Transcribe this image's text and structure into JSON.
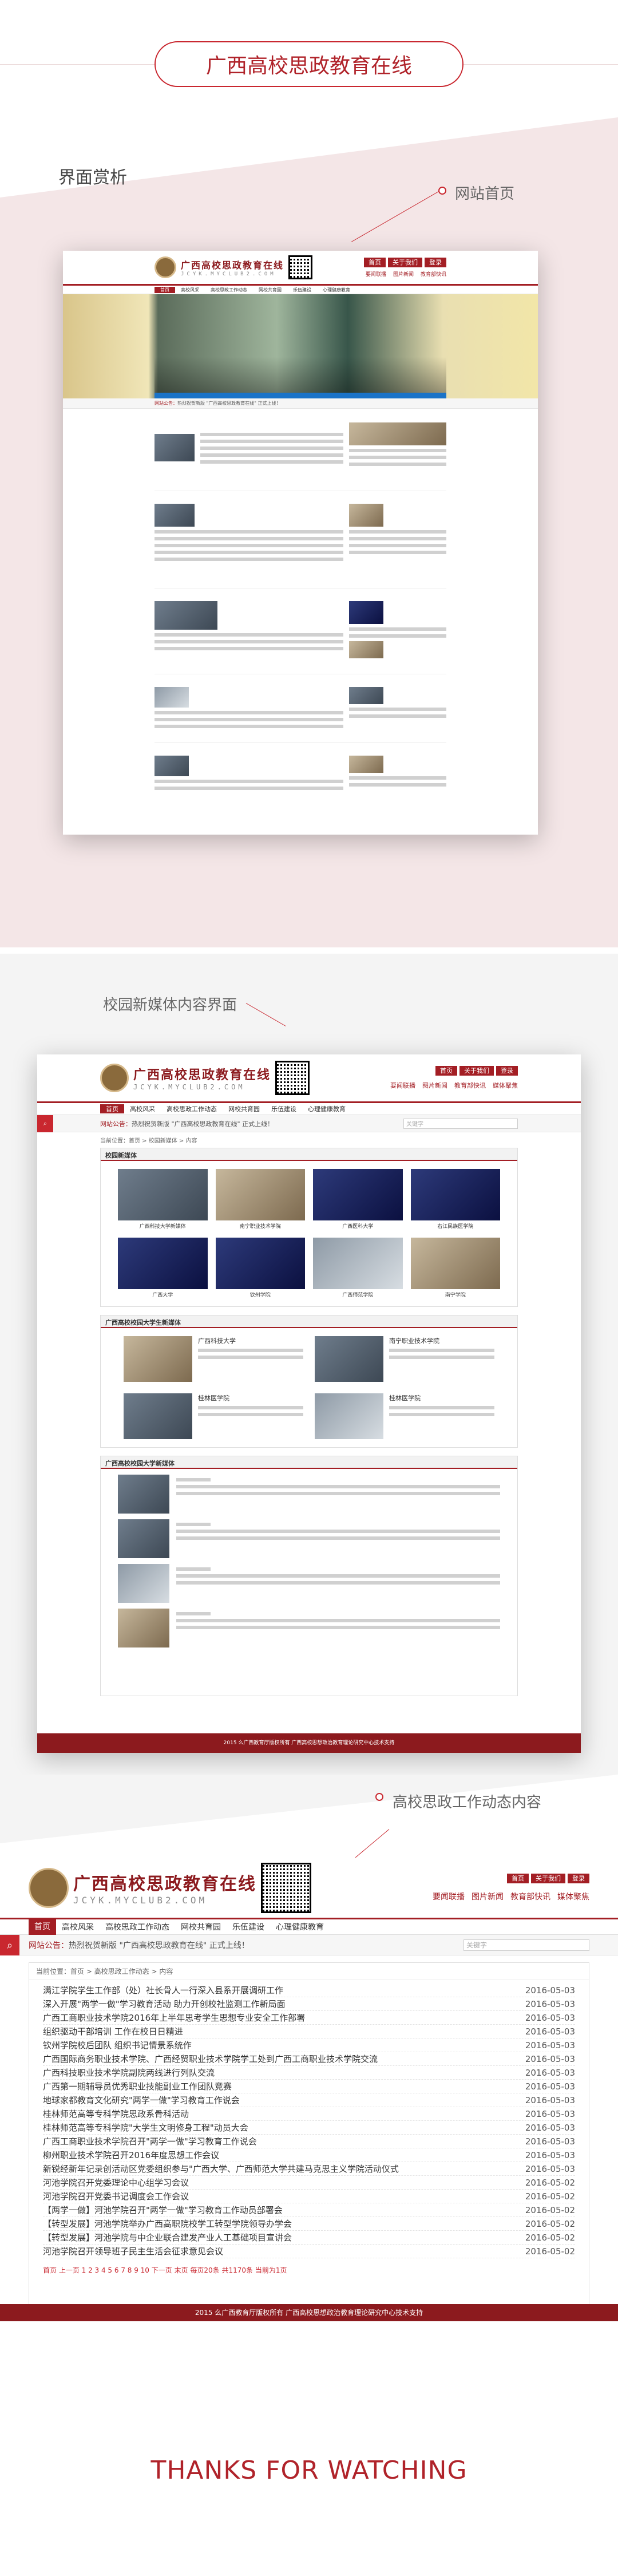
{
  "title": "广西高校思政教育在线",
  "sections": {
    "appreciation": "界面赏析",
    "homepage": "网站首页",
    "media": "校园新媒体内容界面",
    "dynamics": "高校思政工作动态内容",
    "thanks": "THANKS FOR WATCHING"
  },
  "site": {
    "logo_title": "广西高校思政教育在线",
    "logo_sub": "JCYK.MYCLUB2.COM",
    "top_buttons": [
      "首页",
      "关于我们",
      "登录"
    ],
    "top_links": [
      "要闻联播",
      "图片新闻",
      "教育部快讯",
      "媒体聚焦"
    ],
    "nav": [
      "首页",
      "高校风采",
      "高校思政工作动态",
      "网校共育园",
      "乐伍建设",
      "心理健康教育"
    ],
    "notice_label": "网站公告：",
    "notice_text": "热烈祝贺新版 \"广西高校思政教育在线\" 正式上线！",
    "search_placeholder": "关键字",
    "footer": "2015 么广西教育厅版权所有    广西高校思想政治教育理论研究中心技术支持"
  },
  "media": {
    "breadcrumb": "当前位置：首页 > 校园新媒体 > 内容",
    "panel1": "校园新媒体",
    "panel2": "广西高校校园大学生新媒体",
    "panel3": "广西高校校园大学新媒体",
    "schools": [
      "广西科技大学",
      "南宁职业技术学院",
      "桂林医学院",
      "桂林医学院"
    ],
    "thumbs": [
      "广西科技大学新媒体",
      "南宁职业技术学院",
      "广西医科大学",
      "右江民族医学院",
      "广西大学",
      "钦州学院",
      "广西师范学院",
      "南宁学院"
    ]
  },
  "dynamics": {
    "breadcrumb": "当前位置：首页 > 高校思政工作动态 > 内容",
    "items": [
      {
        "t": "满江学院学生工作部（处）社长骨人一行深入县系开展调研工作",
        "d": "2016-05-03"
      },
      {
        "t": "深入开展\"两学一做\"学习教育活动 助力开创校社监测工作新局面",
        "d": "2016-05-03"
      },
      {
        "t": "广西工商职业技术学院2016年上半年思考学生思想专业安全工作部署",
        "d": "2016-05-03"
      },
      {
        "t": "组织驱动干部培训 工作在校日日精进",
        "d": "2016-05-03"
      },
      {
        "t": "钦州学院校后团队 组织书记情景系统作",
        "d": "2016-05-03"
      },
      {
        "t": "广西国际商务职业技术学院、广西经贸职业技术学院学工处到广西工商职业技术学院交流",
        "d": "2016-05-03"
      },
      {
        "t": "广西科技职业技术学院副院两线进行列队交流",
        "d": "2016-05-03"
      },
      {
        "t": "广西第一期辅导员优秀职业技能副业工作团队竞赛",
        "d": "2016-05-03"
      },
      {
        "t": "地球家都教育文化研究\"两学一做\"学习教育工作说会",
        "d": "2016-05-03"
      },
      {
        "t": "桂林师范高等专科学院思政系骨科活动",
        "d": "2016-05-03"
      },
      {
        "t": "桂林师范高等专科学院\"大学生文明修身工程\"动员大会",
        "d": "2016-05-03"
      },
      {
        "t": "广西工商职业技术学院召开\"两学一做\"学习教育工作说会",
        "d": "2016-05-03"
      },
      {
        "t": "柳州职业技术学院召开2016年度思想工作会议",
        "d": "2016-05-03"
      },
      {
        "t": "新锐经新年记录创活动区党委组织参与\"广西大学、广西师范大学共建马克思主义学院活动仪式",
        "d": "2016-05-03"
      },
      {
        "t": "河池学院召开党委理论中心组学习会议",
        "d": "2016-05-02"
      },
      {
        "t": "河池学院召开党委书记调度会工作会议",
        "d": "2016-05-02"
      },
      {
        "t": "【两学一做】河池学院召开\"两学一做\"学习教育工作动员部署会",
        "d": "2016-05-02"
      },
      {
        "t": "【转型发展】河池学院举办广西高职院校学工转型学院领导办学会",
        "d": "2016-05-02"
      },
      {
        "t": "【转型发展】河池学院与中企业联合建发产业人工基础项目宣讲会",
        "d": "2016-05-02"
      },
      {
        "t": "河池学院召开领导班子民主生活会征求意见会议",
        "d": "2016-05-02"
      }
    ],
    "pager": "首页  上一页  1 2 3 4 5 6 7 8 9 10  下一页  末页  每页20条 共1170条 当前为1页"
  }
}
